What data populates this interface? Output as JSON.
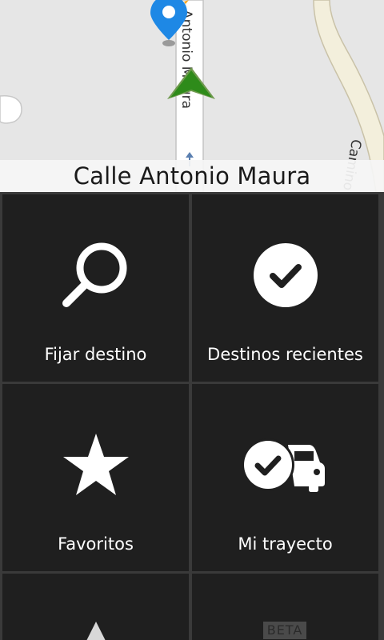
{
  "map": {
    "current_street": "Calle Antonio Maura",
    "road_label_main": "Antonio Maura",
    "road_label_side": "Camino I",
    "road_color": "#ffffff",
    "road_side_color": "#f3efdc",
    "map_bg_color": "#e6e6e6",
    "pin_color": "#1e88e5",
    "nav_arrow_color": "#2e8b1a"
  },
  "menu": {
    "items": [
      {
        "label": "Fijar destino",
        "icon": "search-icon"
      },
      {
        "label": "Destinos recientes",
        "icon": "check-circle-icon"
      },
      {
        "label": "Favoritos",
        "icon": "star-icon"
      },
      {
        "label": "Mi trayecto",
        "icon": "check-car-icon"
      },
      {
        "label": "",
        "icon": "navigation-arrow-icon"
      },
      {
        "label": "",
        "icon": "beta-icon",
        "badge": "BETA"
      }
    ]
  }
}
